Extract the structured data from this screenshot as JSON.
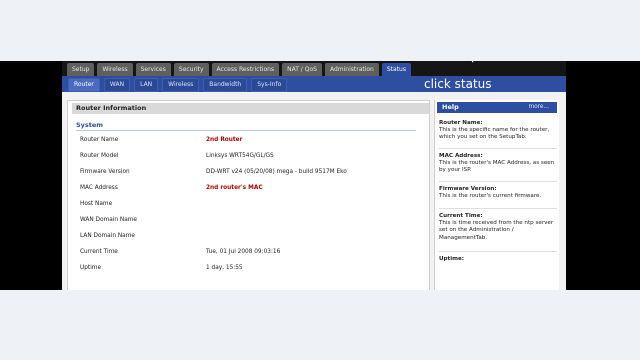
{
  "colors": {
    "accent": "#2d4ea1",
    "highlight_text": "#b30000"
  },
  "nav": {
    "tabs": [
      {
        "label": "Setup"
      },
      {
        "label": "Wireless"
      },
      {
        "label": "Services"
      },
      {
        "label": "Security"
      },
      {
        "label": "Access Restrictions"
      },
      {
        "label": "NAT / QoS"
      },
      {
        "label": "Administration"
      },
      {
        "label": "Status",
        "active": true
      }
    ],
    "subtabs": [
      {
        "label": "Router",
        "active": true
      },
      {
        "label": "WAN"
      },
      {
        "label": "LAN"
      },
      {
        "label": "Wireless"
      },
      {
        "label": "Bandwidth"
      },
      {
        "label": "Sys-Info"
      }
    ]
  },
  "callout": "click status",
  "main": {
    "title": "Router Information",
    "section": "System",
    "rows": [
      {
        "label": "Router Name",
        "value": "2nd Router",
        "highlight": true
      },
      {
        "label": "Router Model",
        "value": "Linksys WRT54G/GL/GS"
      },
      {
        "label": "Firmware Version",
        "value": "DD-WRT v24 (05/20/08) mega - build 9517M Eko"
      },
      {
        "label": "MAC Address",
        "value": "2nd router's MAC",
        "highlight": true
      },
      {
        "label": "Host Name",
        "value": ""
      },
      {
        "label": "WAN Domain Name",
        "value": ""
      },
      {
        "label": "LAN Domain Name",
        "value": ""
      },
      {
        "label": "Current Time",
        "value": "Tue, 01 Jul 2008 09:03:16"
      },
      {
        "label": "Uptime",
        "value": "1 day, 15:55"
      }
    ]
  },
  "help": {
    "title": "Help",
    "more": "more...",
    "items": [
      {
        "heading": "Router Name:",
        "text": "This is the specific name for the router, which you set on the SetupTab."
      },
      {
        "heading": "MAC Address:",
        "text": "This is the router's MAC Address, as seen by your ISP."
      },
      {
        "heading": "Firmware Version:",
        "text": "This is the router's current firmware."
      },
      {
        "heading": "Current Time:",
        "text": "This is time received from the ntp server set on the Administration / ManagementTab."
      },
      {
        "heading": "Uptime:",
        "text": ""
      }
    ]
  }
}
